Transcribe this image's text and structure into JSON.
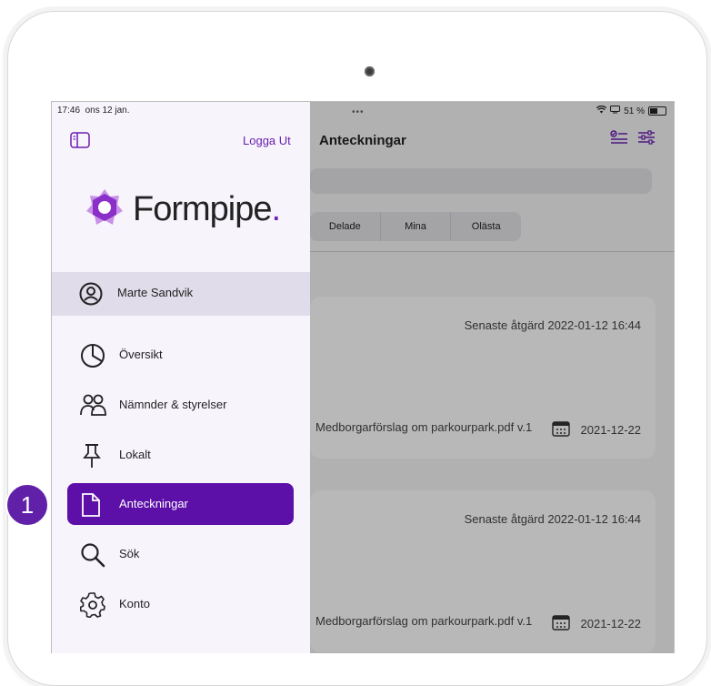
{
  "status_bar": {
    "time": "17:46",
    "date": "ons 12 jan.",
    "battery": "51 %"
  },
  "sidebar": {
    "logout_label": "Logga Ut",
    "logo_text": "Formpipe",
    "user_name": "Marte Sandvik",
    "items": [
      {
        "label": "Översikt",
        "icon": "pie-chart-icon"
      },
      {
        "label": "Nämnder & styrelser",
        "icon": "people-icon"
      },
      {
        "label": "Lokalt",
        "icon": "pin-icon"
      },
      {
        "label": "Anteckningar",
        "icon": "document-icon",
        "active": true
      },
      {
        "label": "Sök",
        "icon": "search-icon"
      },
      {
        "label": "Konto",
        "icon": "gear-icon"
      }
    ]
  },
  "main": {
    "title": "Anteckningar",
    "tabs": [
      "Delade",
      "Mina",
      "Olästa"
    ],
    "cards": [
      {
        "latest_action": "Senaste åtgärd  2022-01-12 16:44",
        "file": "Medborgarförslag om parkourpark.pdf v.1",
        "date": "2021-12-22"
      },
      {
        "latest_action": "Senaste åtgärd  2022-01-12 16:44",
        "file": "Medborgarförslag om parkourpark.pdf v.1",
        "date": "2021-12-22"
      }
    ]
  },
  "callout": {
    "number": "1"
  },
  "colors": {
    "accent": "#5c10a8",
    "sidebar_bg": "#f7f4fc",
    "selected_row": "#e0dce9"
  }
}
